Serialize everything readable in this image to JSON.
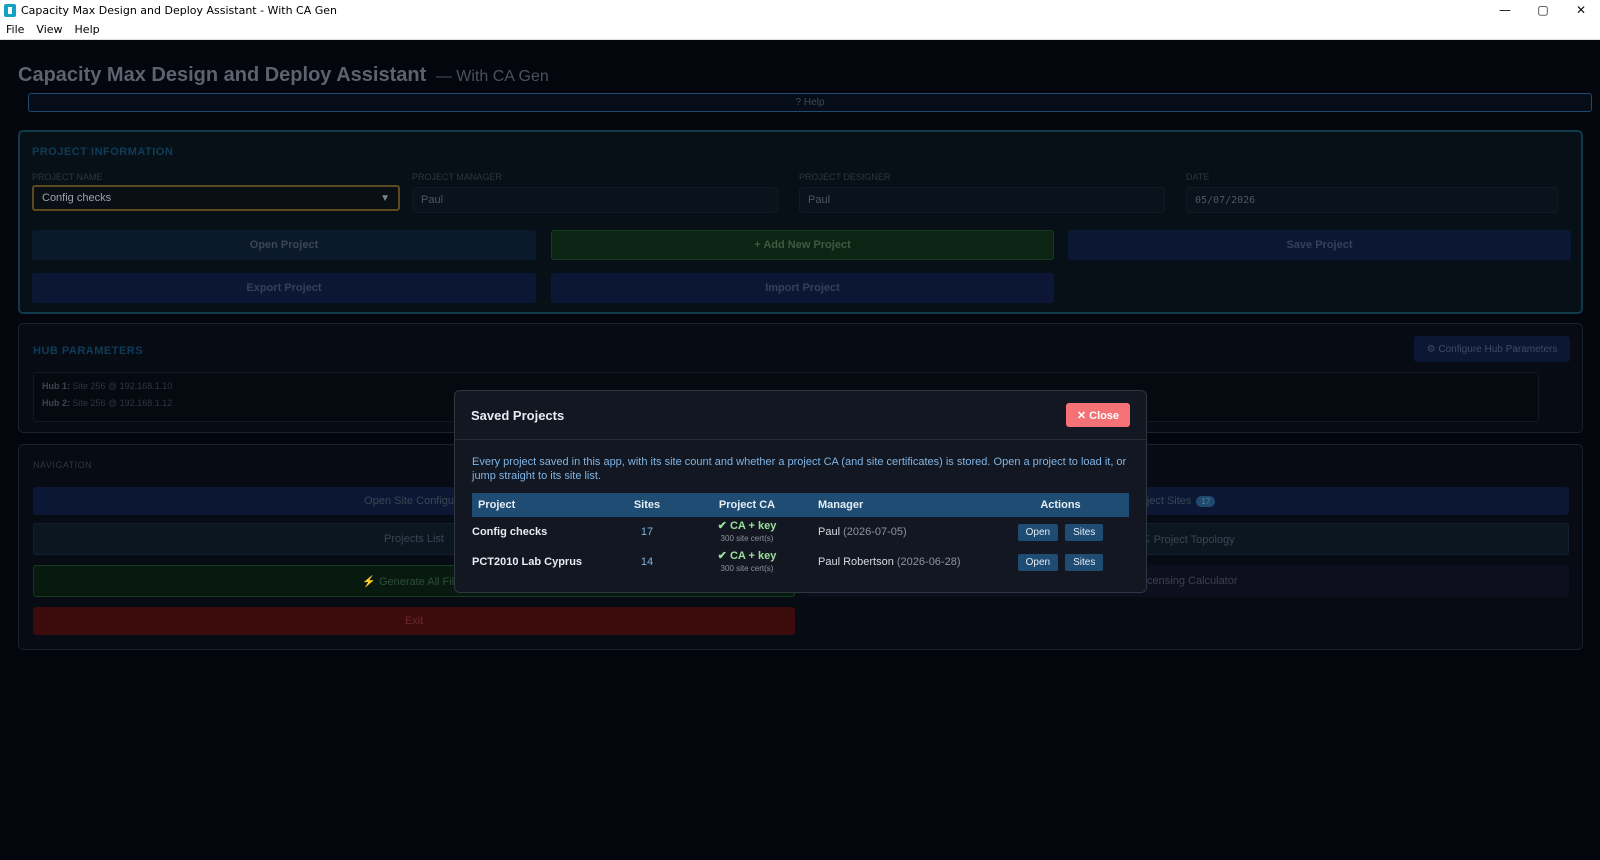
{
  "window": {
    "title": "Capacity Max Design and Deploy Assistant - With CA Gen",
    "minimize": "—",
    "maximize": "▢",
    "close": "✕"
  },
  "menu": [
    "File",
    "View",
    "Help"
  ],
  "header": {
    "title": "Capacity Max Design and Deploy Assistant",
    "subtitle": "— With CA Gen",
    "help": "? Help"
  },
  "project_info": {
    "heading": "PROJECT INFORMATION",
    "name_label": "PROJECT NAME",
    "name_value": "Config checks",
    "manager_label": "PROJECT MANAGER",
    "manager_value": "Paul",
    "designer_label": "PROJECT DESIGNER",
    "designer_value": "Paul",
    "date_label": "DATE",
    "date_value": "05/07/2026",
    "buttons": {
      "open": "Open Project",
      "add": "+ Add New Project",
      "save": "Save Project",
      "export": "Export Project",
      "import": "Import Project"
    }
  },
  "hub": {
    "heading": "HUB PARAMETERS",
    "configure": "⚙ Configure Hub Parameters",
    "hubs": [
      {
        "label": "Hub 1:",
        "value": "Site 256 @ 192.168.1.10"
      },
      {
        "label": "Hub 2:",
        "value": "Site 256 @ 192.168.1.12"
      }
    ]
  },
  "navigation": {
    "heading": "NAVIGATION",
    "open_site_config": "Open Site Configura",
    "project_sites": "roject Sites",
    "project_sites_count": "17",
    "projects_list": "Projects List",
    "project_topology": "⇱ Project Topology",
    "generate_all": "⚡ Generate All Files",
    "licensing": "Licensing Calculator",
    "exit": "Exit"
  },
  "modal": {
    "title": "Saved Projects",
    "close": "✕ Close",
    "description": "Every project saved in this app, with its site count and whether a project CA (and site certificates) is stored. Open a project to load it, or jump straight to its site list.",
    "columns": [
      "Project",
      "Sites",
      "Project CA",
      "Manager",
      "Actions"
    ],
    "rows": [
      {
        "project": "Config checks",
        "sites": "17",
        "ca": "✔ CA + key",
        "certs": "300 site cert(s)",
        "manager": "Paul",
        "date": "(2026-07-05)",
        "open": "Open",
        "sites_btn": "Sites"
      },
      {
        "project": "PCT2010 Lab Cyprus",
        "sites": "14",
        "ca": "✔ CA + key",
        "certs": "300 site cert(s)",
        "manager": "Paul Robertson",
        "date": "(2026-06-28)",
        "open": "Open",
        "sites_btn": "Sites"
      }
    ]
  }
}
